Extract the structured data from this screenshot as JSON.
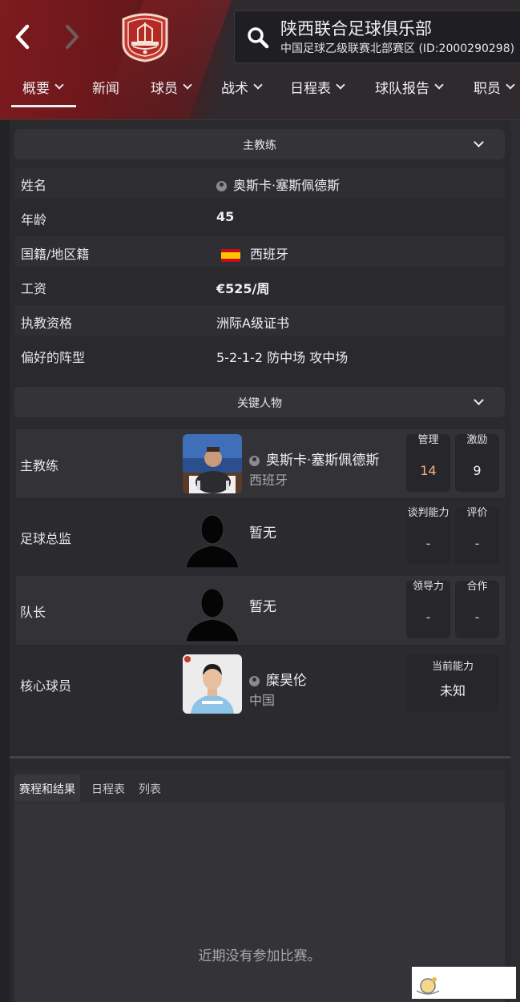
{
  "header": {
    "back_icon": "chevron-left-icon",
    "forward_icon": "chevron-right-icon",
    "club_name": "陕西联合足球俱乐部",
    "club_subtitle": "中国足球乙级联赛北部赛区 (ID:2000290298)",
    "search_icon": "search-icon"
  },
  "tabs": [
    {
      "label": "概要",
      "has_dropdown": true,
      "active": true
    },
    {
      "label": "新闻",
      "has_dropdown": false
    },
    {
      "label": "球员",
      "has_dropdown": true
    },
    {
      "label": "战术",
      "has_dropdown": true
    },
    {
      "label": "日程表",
      "has_dropdown": true
    },
    {
      "label": "球队报告",
      "has_dropdown": true
    },
    {
      "label": "职员",
      "has_dropdown": true
    }
  ],
  "head_coach_panel": {
    "title": "主教练",
    "rows": [
      {
        "label": "姓名",
        "value": "奥斯卡·塞斯佩德斯"
      },
      {
        "label": "年龄",
        "value": "45"
      },
      {
        "label": "国籍/地区籍",
        "value": "西班牙"
      },
      {
        "label": "工资",
        "value": "€525/周"
      },
      {
        "label": "执教资格",
        "value": "洲际A级证书"
      },
      {
        "label": "偏好的阵型",
        "value": "5-2-1-2 防中场 攻中场"
      }
    ]
  },
  "key_people_panel": {
    "title": "关键人物",
    "rows": [
      {
        "role": "主教练",
        "name": "奥斯卡·塞斯佩德斯",
        "nationality": "西班牙",
        "attr1_label": "管理",
        "attr1_value": "14",
        "attr2_label": "激励",
        "attr2_value": "9"
      },
      {
        "role": "足球总监",
        "name": "暂无",
        "attr1_label": "谈判能力",
        "attr1_value": "-",
        "attr2_label": "评价",
        "attr2_value": "-"
      },
      {
        "role": "队长",
        "name": "暂无",
        "attr1_label": "领导力",
        "attr1_value": "-",
        "attr2_label": "合作",
        "attr2_value": "-"
      },
      {
        "role": "核心球员",
        "name": "糜昊伦",
        "nationality": "中国",
        "attr1_label": "当前能力",
        "attr1_value": "未知"
      }
    ]
  },
  "fixtures_panel": {
    "tabs": [
      "赛程和结果",
      "日程表",
      "列表"
    ],
    "empty_message": "近期没有参加比赛。"
  },
  "colors": {
    "brand_red": "#7e1b1e",
    "highlight_value": "#f0b080"
  }
}
